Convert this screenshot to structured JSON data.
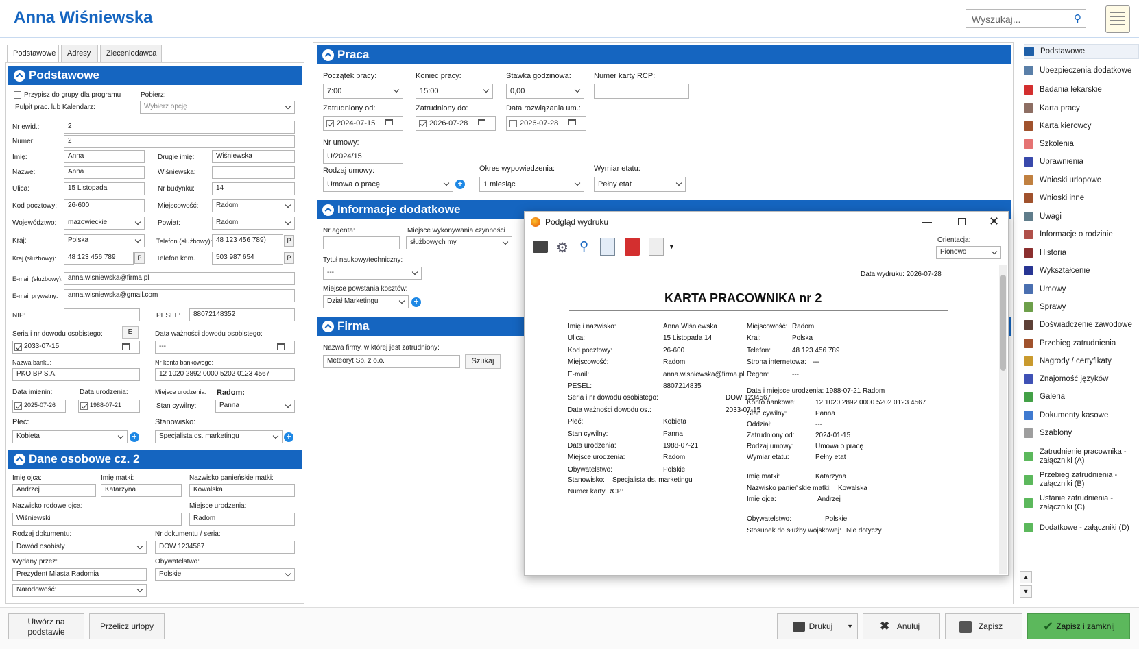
{
  "header": {
    "title": "Anna Wiśniewska",
    "search_placeholder": "Wyszukaj..."
  },
  "tabs": [
    "Podstawowe",
    "Adresy",
    "Zleceniodawca"
  ],
  "podstawowe": {
    "section": "Podstawowe",
    "assign": "Przypisz do grupy dla programu",
    "assign2": "Pulpit prac. lub Kalendarz:",
    "pobierz": "Pobierz:",
    "wybierz": "Wybierz opcję",
    "nr_ewid_l": "Nr ewid.:",
    "nr_ewid": "2",
    "numer_l": "Numer:",
    "numer": "2",
    "imie_l": "Imię:",
    "imie": "Anna",
    "drugie_l": "Drugie imię:",
    "drugie": "Wiśniewska",
    "nazwe_l": "Nazwe:",
    "nazwe": "Anna",
    "wis_l": "Wiśniewska:",
    "wis": "",
    "ulica_l": "Ulica:",
    "ulica": "15 Listopada",
    "nrb_l": "Nr budynku:",
    "nrb": "14",
    "kod_l": "Kod pocztowy:",
    "kod": "26-600",
    "miejsc_l": "Miejscowość:",
    "miejsc": "Radom",
    "woj_l": "Województwo:",
    "woj": "mazowieckie",
    "pow_l": "Powiat:",
    "pow": "Radom",
    "kraj_l": "Kraj:",
    "kraj": "Polska",
    "tel_sl_l": "Telefon (służbowy):",
    "tel_sl": "48 123 456 789)",
    "kraj_sl_l": "Kraj (służbowy):",
    "kraj_sl": "48 123 456 789",
    "tel_kom_l": "Telefon kom.",
    "tel_kom": "503 987 654",
    "p": "P",
    "email_sl_l": "E-mail (służbowy):",
    "email_sl": "anna.wisniewska@firma.pl",
    "email_pr_l": "E-mail prywatny:",
    "email_pr": "anna.wisniewska@gmail.com",
    "nip_l": "NIP:",
    "nip": "",
    "pesel_l": "PESEL:",
    "pesel": "88072148352",
    "dowod_l": "Seria i nr dowodu osobistego:",
    "e": "E",
    "dowod_date": "2033-07-15",
    "waz_l": "Data ważności dowodu osobistego:",
    "waz": "---",
    "bank_l": "Nazwa banku:",
    "bank": "PKO BP S.A.",
    "konto_l": "Nr konta bankowego:",
    "konto": "12 1020 2892 0000 5202 0123 4567",
    "imien_l": "Data imienin:",
    "imien": "2025-07-26",
    "urodz_l": "Data urodzenia:",
    "urodz": "1988-07-21",
    "miejsce_ur_l": "Miejsce urodzenia:",
    "radom_l": "Radom:",
    "stan_l": "Stan cywilny:",
    "stan": "Panna",
    "plec_l": "Płeć:",
    "plec": "Kobieta",
    "stanow_l": "Stanowisko:",
    "stanow": "Specjalista ds. marketingu"
  },
  "dane": {
    "section": "Dane osobowe cz. 2",
    "ojca_l": "Imię ojca:",
    "ojca": "Andrzej",
    "matki_l": "Imię matki:",
    "matki": "Katarzyna",
    "panien_l": "Nazwisko panieńskie matki:",
    "panien": "Kowalska",
    "rod_l": "Nazwisko rodowe ojca:",
    "rod": "Wiśniewski",
    "mur_l": "Miejsce urodzenia:",
    "mur": "Radom",
    "rdok_l": "Rodzaj dokumentu:",
    "rdok": "Dowód osobisty",
    "nrdok_l": "Nr dokumentu / seria:",
    "nrdok": "DOW 1234567",
    "wyd_l": "Wydany przez:",
    "wyd": "Prezydent Miasta Radomia",
    "obyw_l": "Obywatelstwo:",
    "obyw": "Polskie",
    "narod": "Narodowość:"
  },
  "praca": {
    "section": "Praca",
    "pocz_l": "Początek pracy:",
    "pocz": "7:00",
    "kon_l": "Koniec pracy:",
    "kon": "15:00",
    "stawka_l": "Stawka godzinowa:",
    "stawka": "0,00",
    "rcp_l": "Numer karty RCP:",
    "rcp": "",
    "zod_l": "Zatrudniony od:",
    "zod": "2024-07-15",
    "zdo_l": "Zatrudniony do:",
    "zdo": "2026-07-28",
    "rozw_l": "Data rozwiązania um.:",
    "rozw": "2026-07-28",
    "umowa_l": "Nr umowy:",
    "umowa": "U/2024/15",
    "rodz_l": "Rodzaj umowy:",
    "rodz": "Umowa o pracę",
    "okres_l": "Okres wypowiedzenia:",
    "okres": "1 miesiąc",
    "wymiar_l": "Wymiar etatu:",
    "wymiar": "Pełny etat"
  },
  "info": {
    "section": "Informacje dodatkowe",
    "agent_l": "Nr agenta:",
    "agent": "",
    "miejsce_l": "Miejsce wykonywania czynności",
    "miejsce": "służbowych my",
    "tytul_l": "Tytuł naukowy/techniczny:",
    "tytul": "---",
    "mpk_l": "Miejsce powstania kosztów:",
    "mpk": "Dział Marketingu"
  },
  "firma": {
    "section": "Firma",
    "l": "Nazwa firmy, w której jest zatrudniony:",
    "v": "Meteoryt Sp. z o.o.",
    "szukaj": "Szukaj"
  },
  "sidebar": [
    "Podstawowe",
    "Ubezpieczenia dodatkowe",
    "Badania lekarskie",
    "Karta pracy",
    "Karta kierowcy",
    "Szkolenia",
    "Uprawnienia",
    "Wnioski urlopowe",
    "Wnioski inne",
    "Uwagi",
    "Informacje o rodzinie",
    "Historia",
    "Wykształcenie",
    "Umowy",
    "Sprawy",
    "Doświadczenie zawodowe",
    "Przebieg zatrudnienia",
    "Nagrody / certyfikaty",
    "Znajomość języków",
    "Galeria",
    "Dokumenty kasowe",
    "Szablony"
  ],
  "sidebar2": [
    [
      "Zatrudnienie pracownika -",
      "załączniki (A)"
    ],
    [
      "Przebieg zatrudnienia -",
      "załączniki (B)"
    ],
    [
      "Ustanie zatrudnienia -",
      "załączniki (C)"
    ],
    [
      "Dodatkowe - załączniki (D)",
      ""
    ]
  ],
  "sidebar_colors": [
    "#1e5fa8",
    "#5a7fa8",
    "#d32f2f",
    "#8d6e63",
    "#a0522d",
    "#e57373",
    "#3949ab",
    "#c08040",
    "#a0522d",
    "#607d8b",
    "#b0504a",
    "#8b2f2f",
    "#283593",
    "#4a6fb0",
    "#6d9f4a",
    "#5d4037",
    "#a0522d",
    "#c99a2e",
    "#3f51b5",
    "#43a047",
    "#3f7ad0",
    "#9e9e9e",
    "#5cb85c",
    "#5cb85c",
    "#5cb85c",
    "#5cb85c"
  ],
  "dialog": {
    "title": "Podgląd wydruku",
    "orient_l": "Orientacja:",
    "orient": "Pionowo",
    "date": "Data wydruku: 2026-07-28",
    "heading": "KARTA PRACOWNIKA nr 2",
    "left": [
      [
        "Imię i nazwisko:",
        "Anna Wiśniewska"
      ],
      [
        "Ulica:",
        "15 Listopada 14"
      ],
      [
        "Kod pocztowy:",
        "26-600"
      ],
      [
        "Miejscowość:",
        "Radom"
      ],
      [
        "E-mail:",
        "anna.wisniewska@firma.pl"
      ],
      [
        "PESEL:",
        "8807214835"
      ],
      [
        "Seria i nr dowodu osobistego:",
        "DOW 1234567"
      ],
      [
        "Data ważności dowodu os.:",
        "2033-07-15"
      ],
      [
        "Płeć:",
        "Kobieta"
      ],
      [
        "Stan cywilny:",
        "Panna"
      ],
      [
        "Data urodzenia:",
        "1988-07-21"
      ],
      [
        "Miejsce urodzenia:",
        "Radom"
      ],
      [
        "Obywatelstwo:",
        "Polskie"
      ]
    ],
    "left2": [
      [
        "Stanowisko:",
        "Specjalista ds. marketingu"
      ],
      [
        "Numer karty RCP:",
        ""
      ]
    ],
    "right": [
      [
        "Miejscowość:",
        "Radom"
      ],
      [
        "Kraj:",
        "Polska"
      ],
      [
        "Telefon:",
        "48 123 456 789"
      ],
      [
        "Strona internetowa:",
        "---"
      ],
      [
        "Regon:",
        "---"
      ]
    ],
    "right_urodz": "Data i miejsce urodzenia: 1988-07-21 Radom",
    "right2": [
      [
        "Konto bankowe:",
        "12 1020 2892 0000 5202 0123 4567"
      ],
      [
        "Stan cywilny:",
        "Panna"
      ],
      [
        "Oddział:",
        "---"
      ],
      [
        "Zatrudniony od:",
        "2024-01-15"
      ],
      [
        "Rodzaj umowy:",
        "Umowa o pracę"
      ],
      [
        "Wymiar etatu:",
        "Pełny etat"
      ]
    ],
    "right3": [
      [
        "Imię matki:",
        "Katarzyna"
      ],
      [
        "Nazwisko panieńskie matki:",
        "Kowalska"
      ],
      [
        "Imię ojca:",
        "Andrzej"
      ]
    ],
    "right4": [
      [
        "Obywatelstwo:",
        "Polskie"
      ],
      [
        "Stosunek do służby wojskowej:",
        "Nie dotyczy"
      ]
    ]
  },
  "footer": {
    "utworz": [
      "Utwórz na",
      "podstawie"
    ],
    "przelicz": "Przelicz urlopy",
    "drukuj": "Drukuj",
    "anuluj": "Anuluj",
    "zapisz": "Zapisz",
    "zapisz_zamknij": "Zapisz i zamknij"
  }
}
